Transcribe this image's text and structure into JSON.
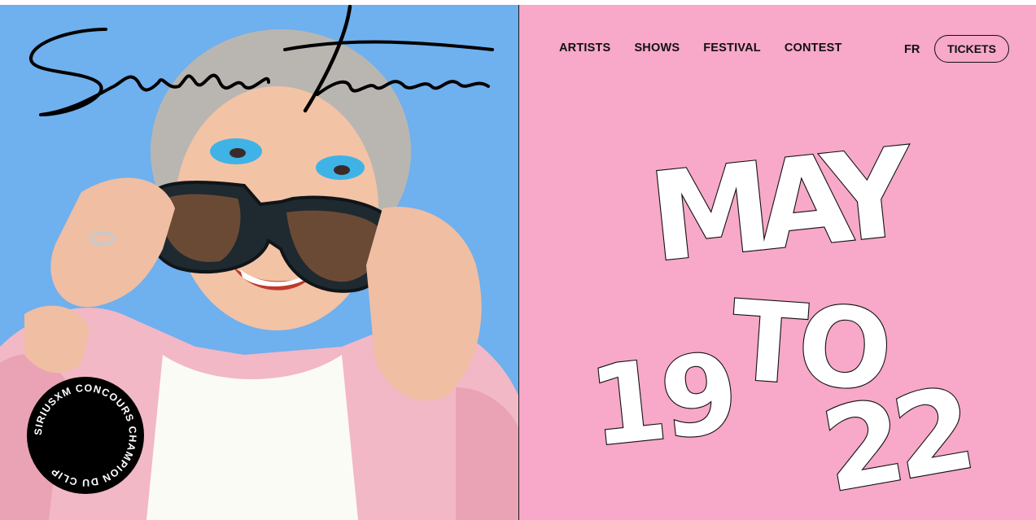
{
  "brand": {
    "logo_text": "Santa Teresa"
  },
  "badge": {
    "text": "SIRIUSXM CONCOURS CHAMPION DU CLIP"
  },
  "nav": {
    "items": [
      {
        "label": "ARTISTS"
      },
      {
        "label": "SHOWS"
      },
      {
        "label": "FESTIVAL"
      },
      {
        "label": "CONTEST"
      }
    ],
    "language": "FR",
    "tickets": "TICKETS"
  },
  "dates": {
    "month": "MAY",
    "start_day": "19",
    "connector": "TO",
    "end_day": "22"
  },
  "colors": {
    "hero_bg": "#6fb0ee",
    "panel_bg": "#f8a8c8",
    "bubble_fill": "#ffffff",
    "ink": "#111111"
  }
}
